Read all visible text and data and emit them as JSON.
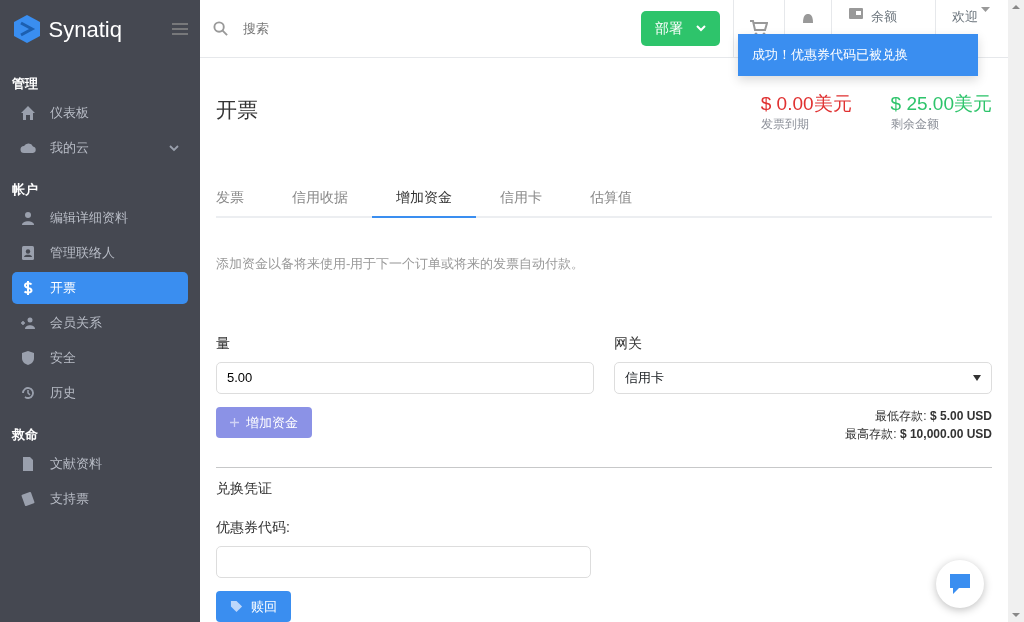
{
  "sidebar": {
    "brand": "Synatiq",
    "sections": [
      {
        "title": "管理",
        "items": [
          {
            "label": "仪表板",
            "selected": false,
            "expandable": false
          },
          {
            "label": "我的云",
            "selected": false,
            "expandable": true
          }
        ]
      },
      {
        "title": "帐户",
        "items": [
          {
            "label": "编辑详细资料",
            "selected": false,
            "expandable": false
          },
          {
            "label": "管理联络人",
            "selected": false,
            "expandable": false
          },
          {
            "label": "开票",
            "selected": true,
            "expandable": false
          },
          {
            "label": "会员关系",
            "selected": false,
            "expandable": false
          },
          {
            "label": "安全",
            "selected": false,
            "expandable": false
          },
          {
            "label": "历史",
            "selected": false,
            "expandable": false
          }
        ]
      },
      {
        "title": "救命",
        "items": [
          {
            "label": "文献资料",
            "selected": false,
            "expandable": false
          },
          {
            "label": "支持票",
            "selected": false,
            "expandable": false
          }
        ]
      }
    ]
  },
  "topbar": {
    "search": {
      "placeholder": "搜索"
    },
    "deploy_button": "部署",
    "balance_label": "余额",
    "welcome": "欢迎"
  },
  "toast": {
    "message": "成功！优惠券代码已被兑换"
  },
  "page": {
    "title": "开票",
    "summary": [
      {
        "amount": "$ 0.00美元",
        "caption": "发票到期",
        "kind": "due"
      },
      {
        "amount": "$ 25.00美元",
        "caption": "剩余金额",
        "kind": "credit"
      }
    ],
    "tabs": [
      {
        "label": "发票",
        "selected": false
      },
      {
        "label": "信用收据",
        "selected": false
      },
      {
        "label": "增加资金",
        "selected": true
      },
      {
        "label": "信用卡",
        "selected": false
      },
      {
        "label": "估算值",
        "selected": false
      }
    ],
    "description": "添加资金以备将来使用-用于下一个订单或将来的发票自动付款。",
    "amount": {
      "label": "量",
      "value": "5.00"
    },
    "gateway": {
      "label": "网关",
      "value": "信用卡"
    },
    "add_button": {
      "label": "增加资金",
      "disabled": true
    },
    "limits": [
      {
        "label": "最低存款:",
        "value": "$ 5.00 USD"
      },
      {
        "label": "最高存款:",
        "value": "$ 10,000.00 USD"
      }
    ],
    "redeem": {
      "title": "兑换凭证",
      "field_label": "优惠券代码:",
      "button": "赎回"
    }
  }
}
